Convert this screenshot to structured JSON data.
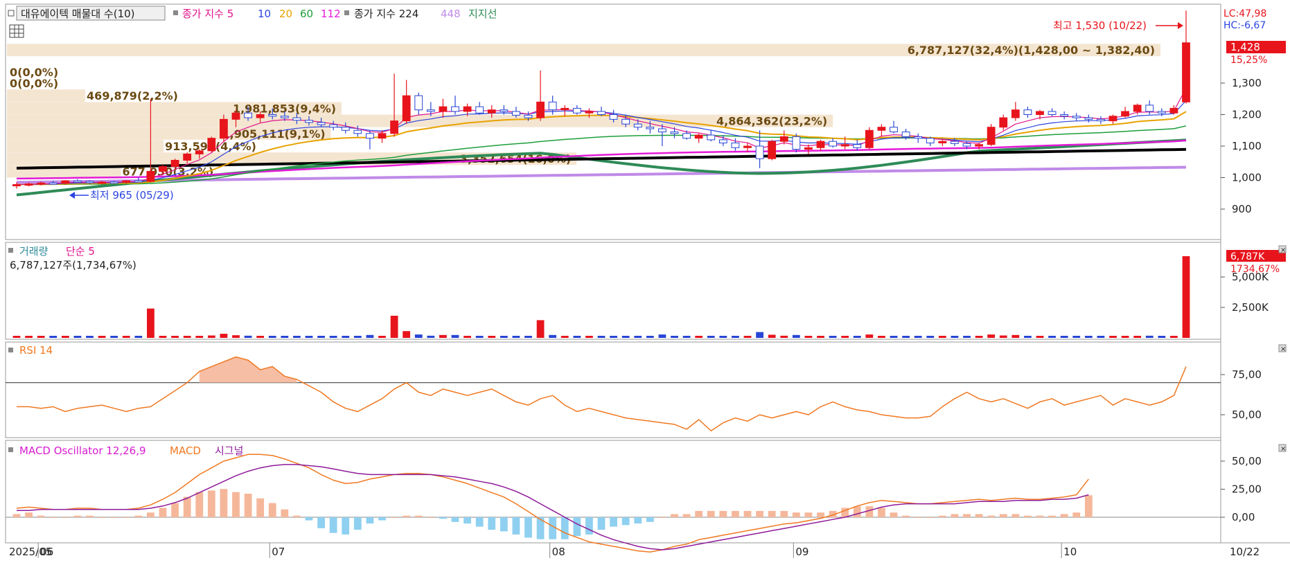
{
  "price_panel": {
    "legend": [
      {
        "text": "대유에이텍 매물대 수(10)",
        "color": "#222222"
      },
      {
        "text": "종가 지수 5",
        "color": "#e0138c"
      },
      {
        "text": "10",
        "color": "#2b44e0"
      },
      {
        "text": "20",
        "color": "#e8a200"
      },
      {
        "text": "60",
        "color": "#1c9e3a"
      },
      {
        "text": "112",
        "color": "#e41ad8"
      },
      {
        "text": "종가 지수 224",
        "color": "#222222"
      },
      {
        "text": "448",
        "color": "#c08ae8"
      },
      {
        "text": "지지선",
        "color": "#2e8b57"
      }
    ],
    "lc": "LC:47,98",
    "hc": "HC:-6,67",
    "high_annot": "최고 1,530 (10/22)",
    "low_annot": "최저 965 (05/29)",
    "last_price": "1,428",
    "last_pct": "15,25%",
    "axis_ticks": [
      "1,300",
      "1,200",
      "1,100",
      "1,000",
      "900"
    ],
    "volume_profile": [
      {
        "price": 1405,
        "label": "6,787,127(32,4%)(1,428,00 ~ 1,382,40)",
        "pct": 32.4
      },
      {
        "price": 1335,
        "label": "0(0,0%)",
        "pct": 0
      },
      {
        "price": 1300,
        "label": "0(0,0%)",
        "pct": 0
      },
      {
        "price": 1260,
        "label": "469,879(2,2%)",
        "pct": 2.2
      },
      {
        "price": 1220,
        "label": "1,981,853(9,4%)",
        "pct": 9.4
      },
      {
        "price": 1180,
        "label": "4,864,362(23,2%)",
        "pct": 23.2
      },
      {
        "price": 1140,
        "label": "1,905,111(9,1%)",
        "pct": 9.1
      },
      {
        "price": 1100,
        "label": "913,599(4,4%)",
        "pct": 4.4
      },
      {
        "price": 1060,
        "label": "3,352,654(16,0%)",
        "pct": 16.0
      },
      {
        "price": 1020,
        "label": "677,030(3,2%)",
        "pct": 3.2
      }
    ]
  },
  "volume_panel": {
    "title": "거래량",
    "ma_label": "단순 5",
    "info": "6,787,127주(1,734,67%)",
    "last_value": "6,787K",
    "last_pct": "1734,67%",
    "axis_ticks": [
      "5,000K",
      "2,500K"
    ]
  },
  "rsi_panel": {
    "title": "RSI 14",
    "axis_ticks": [
      "75,00",
      "50,00"
    ]
  },
  "macd_panel": {
    "legend": [
      {
        "text": "MACD Oscillator 12,26,9",
        "color": "#d81bd0"
      },
      {
        "text": "MACD",
        "color": "#f07820"
      },
      {
        "text": "시그널",
        "color": "#8e1a9a"
      }
    ],
    "axis_ticks": [
      "50,00",
      "25,00",
      "0,00"
    ]
  },
  "x_axis": {
    "labels": [
      "2025/05",
      "06",
      "07",
      "08",
      "09",
      "10"
    ],
    "last_date": "10/22"
  },
  "colors": {
    "up": "#e8141c",
    "down": "#2745d6",
    "ma5": "#e0138c",
    "ma10": "#2b44e0",
    "ma20": "#e8a200",
    "ma60": "#1c9e3a",
    "ma112": "#e41ad8",
    "ma224": "#000000",
    "ma448": "#c08ae8",
    "support": "#2e8b57",
    "rsi": "#f07820",
    "macd": "#f07820",
    "signal": "#8e1a9a",
    "osc_pos": "#f5b79a",
    "osc_neg": "#8fd0f0",
    "profile": "#f3e2cc"
  },
  "chart_data": {
    "type": "candlestick",
    "dates": [
      "05-29",
      "05-30",
      "06-02",
      "06-04",
      "06-05",
      "06-09",
      "06-10",
      "06-11",
      "06-12",
      "06-13",
      "06-16",
      "06-17",
      "06-18",
      "06-19",
      "06-20",
      "06-23",
      "06-24",
      "06-25",
      "06-26",
      "06-27",
      "06-30",
      "07-01",
      "07-02",
      "07-03",
      "07-04",
      "07-07",
      "07-08",
      "07-09",
      "07-10",
      "07-11",
      "07-14",
      "07-15",
      "07-16",
      "07-17",
      "07-18",
      "07-21",
      "07-22",
      "07-23",
      "07-24",
      "07-25",
      "07-28",
      "07-29",
      "07-30",
      "07-31",
      "08-01",
      "08-04",
      "08-05",
      "08-06",
      "08-07",
      "08-08",
      "08-11",
      "08-12",
      "08-13",
      "08-14",
      "08-18",
      "08-19",
      "08-20",
      "08-21",
      "08-22",
      "08-25",
      "08-26",
      "08-27",
      "08-28",
      "08-29",
      "09-01",
      "09-02",
      "09-03",
      "09-04",
      "09-05",
      "09-08",
      "09-09",
      "09-10",
      "09-11",
      "09-12",
      "09-15",
      "09-16",
      "09-17",
      "09-18",
      "09-19",
      "09-22",
      "09-23",
      "09-24",
      "09-25",
      "09-26",
      "09-29",
      "09-30",
      "10-01",
      "10-02",
      "10-10",
      "10-13",
      "10-14",
      "10-15",
      "10-16",
      "10-17",
      "10-20",
      "10-21",
      "10-22"
    ],
    "series": [
      {
        "name": "OHLC",
        "values": [
          [
            975,
            985,
            965,
            978
          ],
          [
            978,
            985,
            972,
            980
          ],
          [
            980,
            988,
            975,
            983
          ],
          [
            983,
            990,
            978,
            982
          ],
          [
            982,
            992,
            978,
            990
          ],
          [
            990,
            995,
            984,
            988
          ],
          [
            988,
            992,
            980,
            984
          ],
          [
            984,
            990,
            978,
            986
          ],
          [
            986,
            990,
            982,
            985
          ],
          [
            985,
            992,
            980,
            990
          ],
          [
            990,
            1000,
            985,
            988
          ],
          [
            988,
            1250,
            985,
            1020
          ],
          [
            1020,
            1040,
            1010,
            1035
          ],
          [
            1035,
            1060,
            1025,
            1055
          ],
          [
            1055,
            1080,
            1045,
            1075
          ],
          [
            1075,
            1090,
            1060,
            1085
          ],
          [
            1085,
            1130,
            1080,
            1125
          ],
          [
            1125,
            1200,
            1115,
            1185
          ],
          [
            1185,
            1215,
            1160,
            1205
          ],
          [
            1205,
            1225,
            1180,
            1190
          ],
          [
            1190,
            1210,
            1175,
            1200
          ],
          [
            1200,
            1220,
            1185,
            1195
          ],
          [
            1195,
            1210,
            1180,
            1190
          ],
          [
            1190,
            1205,
            1170,
            1182
          ],
          [
            1182,
            1195,
            1165,
            1175
          ],
          [
            1175,
            1190,
            1160,
            1168
          ],
          [
            1168,
            1180,
            1150,
            1160
          ],
          [
            1160,
            1175,
            1140,
            1150
          ],
          [
            1150,
            1165,
            1130,
            1140
          ],
          [
            1140,
            1150,
            1090,
            1125
          ],
          [
            1125,
            1150,
            1110,
            1140
          ],
          [
            1140,
            1330,
            1130,
            1180
          ],
          [
            1180,
            1310,
            1170,
            1260
          ],
          [
            1260,
            1270,
            1200,
            1215
          ],
          [
            1215,
            1240,
            1195,
            1210
          ],
          [
            1210,
            1250,
            1190,
            1225
          ],
          [
            1225,
            1260,
            1200,
            1210
          ],
          [
            1210,
            1235,
            1195,
            1225
          ],
          [
            1225,
            1240,
            1200,
            1205
          ],
          [
            1205,
            1230,
            1190,
            1215
          ],
          [
            1215,
            1230,
            1200,
            1210
          ],
          [
            1210,
            1225,
            1190,
            1198
          ],
          [
            1198,
            1210,
            1180,
            1190
          ],
          [
            1190,
            1340,
            1180,
            1240
          ],
          [
            1240,
            1260,
            1200,
            1215
          ],
          [
            1215,
            1230,
            1195,
            1220
          ],
          [
            1220,
            1230,
            1200,
            1205
          ],
          [
            1205,
            1220,
            1190,
            1210
          ],
          [
            1210,
            1225,
            1195,
            1200
          ],
          [
            1200,
            1215,
            1175,
            1185
          ],
          [
            1185,
            1200,
            1160,
            1170
          ],
          [
            1170,
            1185,
            1150,
            1160
          ],
          [
            1160,
            1180,
            1140,
            1155
          ],
          [
            1155,
            1170,
            1100,
            1145
          ],
          [
            1145,
            1160,
            1125,
            1140
          ],
          [
            1140,
            1150,
            1120,
            1125
          ],
          [
            1125,
            1140,
            1110,
            1135
          ],
          [
            1135,
            1150,
            1115,
            1120
          ],
          [
            1120,
            1135,
            1100,
            1110
          ],
          [
            1110,
            1125,
            1085,
            1095
          ],
          [
            1095,
            1110,
            1080,
            1100
          ],
          [
            1100,
            1150,
            1030,
            1060
          ],
          [
            1060,
            1120,
            1055,
            1115
          ],
          [
            1115,
            1150,
            1105,
            1130
          ],
          [
            1130,
            1140,
            1080,
            1090
          ],
          [
            1090,
            1105,
            1075,
            1095
          ],
          [
            1095,
            1120,
            1085,
            1115
          ],
          [
            1115,
            1125,
            1095,
            1100
          ],
          [
            1100,
            1130,
            1090,
            1105
          ],
          [
            1105,
            1120,
            1085,
            1095
          ],
          [
            1095,
            1160,
            1090,
            1150
          ],
          [
            1150,
            1170,
            1130,
            1160
          ],
          [
            1160,
            1180,
            1140,
            1145
          ],
          [
            1145,
            1155,
            1120,
            1130
          ],
          [
            1130,
            1140,
            1110,
            1125
          ],
          [
            1125,
            1130,
            1100,
            1110
          ],
          [
            1110,
            1120,
            1100,
            1115
          ],
          [
            1115,
            1125,
            1100,
            1108
          ],
          [
            1108,
            1115,
            1090,
            1100
          ],
          [
            1100,
            1110,
            1090,
            1105
          ],
          [
            1105,
            1170,
            1100,
            1160
          ],
          [
            1160,
            1200,
            1150,
            1190
          ],
          [
            1190,
            1240,
            1180,
            1215
          ],
          [
            1215,
            1225,
            1190,
            1200
          ],
          [
            1200,
            1215,
            1185,
            1210
          ],
          [
            1210,
            1220,
            1195,
            1200
          ],
          [
            1200,
            1210,
            1185,
            1195
          ],
          [
            1195,
            1205,
            1180,
            1190
          ],
          [
            1190,
            1200,
            1175,
            1185
          ],
          [
            1185,
            1195,
            1170,
            1180
          ],
          [
            1180,
            1200,
            1170,
            1195
          ],
          [
            1195,
            1225,
            1190,
            1210
          ],
          [
            1210,
            1235,
            1200,
            1230
          ],
          [
            1230,
            1245,
            1200,
            1210
          ],
          [
            1210,
            1220,
            1195,
            1205
          ],
          [
            1205,
            1230,
            1200,
            1220
          ],
          [
            1240,
            1530,
            1235,
            1428
          ]
        ]
      },
      {
        "name": "RSI",
        "values": [
          55,
          55,
          54,
          55,
          52,
          54,
          55,
          56,
          54,
          52,
          54,
          55,
          60,
          65,
          70,
          77,
          80,
          83,
          86,
          84,
          78,
          80,
          74,
          72,
          68,
          64,
          58,
          54,
          52,
          56,
          60,
          66,
          70,
          64,
          62,
          66,
          64,
          62,
          64,
          66,
          62,
          58,
          56,
          60,
          62,
          56,
          52,
          54,
          52,
          50,
          48,
          47,
          46,
          45,
          44,
          41,
          47,
          40,
          45,
          48,
          46,
          50,
          48,
          50,
          52,
          50,
          55,
          58,
          55,
          53,
          52,
          50,
          49,
          48,
          48,
          49,
          55,
          60,
          64,
          60,
          58,
          60,
          57,
          54,
          58,
          60,
          56,
          58,
          60,
          62,
          56,
          60,
          58,
          56,
          58,
          62,
          80
        ]
      },
      {
        "name": "MACD",
        "values": [
          8,
          9,
          8,
          7,
          7,
          8,
          8,
          7,
          7,
          7,
          8,
          11,
          16,
          22,
          30,
          38,
          44,
          50,
          53,
          56,
          56,
          55,
          52,
          48,
          44,
          38,
          33,
          30,
          31,
          34,
          36,
          38,
          39,
          39,
          38,
          36,
          33,
          30,
          26,
          22,
          18,
          12,
          5,
          -2,
          -8,
          -14,
          -18,
          -22,
          -24,
          -26,
          -28,
          -30,
          -31,
          -29,
          -26,
          -24,
          -20,
          -18,
          -16,
          -14,
          -12,
          -10,
          -8,
          -6,
          -5,
          -3,
          -1,
          2,
          6,
          10,
          13,
          15,
          14,
          13,
          12,
          12,
          13,
          14,
          15,
          16,
          15,
          16,
          17,
          16,
          16,
          17,
          18,
          20,
          34
        ]
      },
      {
        "name": "시그널",
        "values": [
          6,
          6,
          7,
          7,
          7,
          7,
          7,
          7,
          7,
          7,
          7,
          8,
          10,
          13,
          17,
          22,
          27,
          32,
          37,
          41,
          44,
          46,
          47,
          47,
          46,
          45,
          43,
          41,
          39,
          38,
          38,
          38,
          38,
          38,
          38,
          37,
          36,
          34,
          32,
          30,
          27,
          23,
          18,
          12,
          6,
          0,
          -6,
          -11,
          -16,
          -20,
          -23,
          -26,
          -28,
          -29,
          -28,
          -26,
          -24,
          -22,
          -20,
          -18,
          -16,
          -14,
          -12,
          -10,
          -8,
          -6,
          -4,
          -2,
          0,
          3,
          6,
          9,
          11,
          12,
          12,
          12,
          12,
          12,
          13,
          14,
          14,
          14,
          15,
          15,
          15,
          16,
          16,
          17,
          20
        ]
      }
    ]
  }
}
